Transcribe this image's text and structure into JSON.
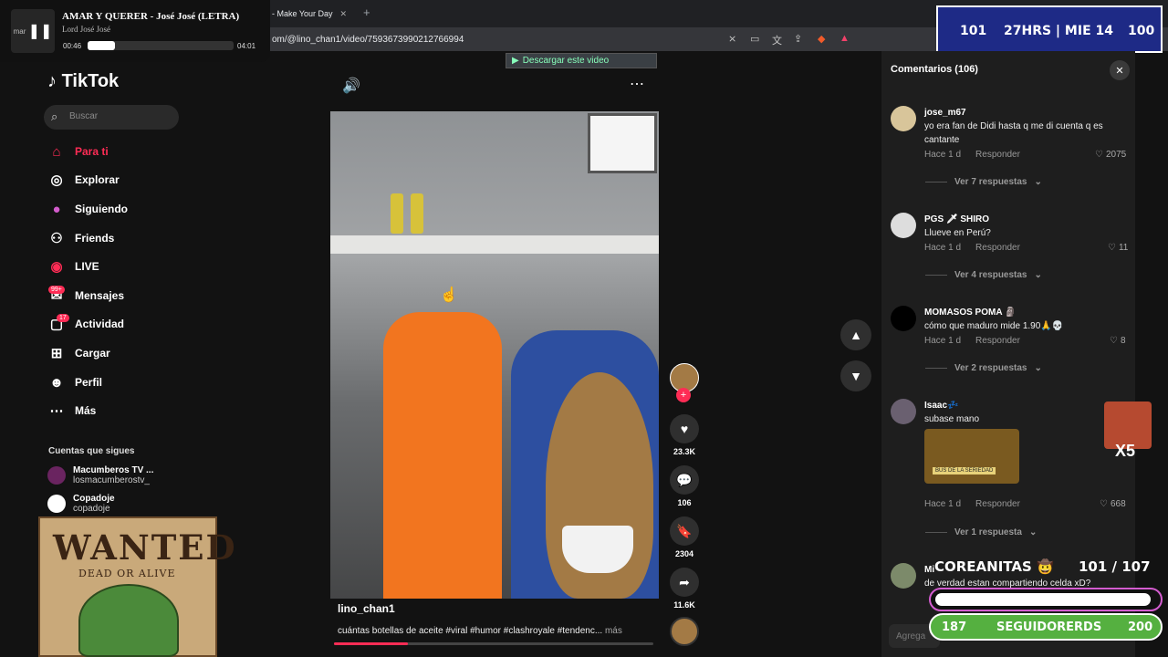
{
  "browser": {
    "tab_title": "- Make Your Day",
    "tab_close": "✕",
    "new_tab": "+",
    "url": "om/@lino_chan1/video/7593673990212766994"
  },
  "music": {
    "art_label": "mar",
    "title": "AMAR Y QUERER - José José (LETRA)",
    "artist": "Lord José José",
    "current": "00:46",
    "duration": "04:01",
    "progress": 0.19
  },
  "stream_top": {
    "left": "101",
    "center": "27HRS | MIE 14",
    "right": "100"
  },
  "download_bar": {
    "label": "Descargar este video"
  },
  "sidebar": {
    "logo": "TikTok",
    "search_placeholder": "Buscar",
    "items": [
      {
        "label": "Para ti",
        "icon": "home-icon"
      },
      {
        "label": "Explorar",
        "icon": "compass-icon"
      },
      {
        "label": "Siguiendo",
        "icon": "following-icon"
      },
      {
        "label": "Friends",
        "icon": "friends-icon"
      },
      {
        "label": "LIVE",
        "icon": "live-icon"
      },
      {
        "label": "Mensajes",
        "icon": "messages-icon",
        "badge": "99+"
      },
      {
        "label": "Actividad",
        "icon": "activity-icon",
        "badge": "17"
      },
      {
        "label": "Cargar",
        "icon": "upload-icon"
      },
      {
        "label": "Perfil",
        "icon": "profile-icon"
      },
      {
        "label": "Más",
        "icon": "more-icon"
      }
    ],
    "following_header": "Cuentas que sigues",
    "accounts": [
      {
        "name": "Macumberos TV ...",
        "handle": "losmacumberostv_"
      },
      {
        "name": "Copadoje",
        "handle": "copadoje"
      }
    ]
  },
  "wanted": {
    "title": "WANTED",
    "subtitle": "DEAD OR ALIVE"
  },
  "video": {
    "author": "lino_chan1",
    "caption": "cuántas botellas de aceite #viral #humor #clashroyale #tendenc...",
    "more": "más",
    "progress": 0.23
  },
  "actions": {
    "likes": "23.3K",
    "comments": "106",
    "saves": "2304",
    "shares": "11.6K"
  },
  "comments": {
    "title": "Comentarios (106)",
    "reply_label": "Responder",
    "items": [
      {
        "user": "jose_m67",
        "text": "yo era fan de Didi hasta q me di cuenta q es cantante",
        "time": "Hace 1 d",
        "likes": "2075",
        "replies": "Ver 7 respuestas"
      },
      {
        "user": "PGS 🗡 SHIRO",
        "text": "Llueve en Perú?",
        "time": "Hace 1 d",
        "likes": "11",
        "replies": "Ver 4 respuestas"
      },
      {
        "user": "MOMASOS POMA 🗿",
        "text": "cómo que maduro mide 1.90🙏💀",
        "time": "Hace 1 d",
        "likes": "8",
        "replies": "Ver 2 respuestas"
      },
      {
        "user": "Isaac💤",
        "text": "subase mano",
        "image_label": "BUS DE LA SERIEDAD",
        "time": "Hace 1 d",
        "likes": "668",
        "replies": "Ver 1 respuesta"
      },
      {
        "user": "Mi",
        "text": "de verdad estan compartiendo celda xD?"
      }
    ],
    "add_placeholder": "Agrega"
  },
  "stream_bottom": {
    "sub_title": "COREANITAS 🤠",
    "sub_count": "101  /  107",
    "follower_left": "187",
    "follower_label": "SEGUIDORERDS",
    "follower_right": "200",
    "emote_mult": "X5"
  },
  "colors": {
    "accent": "#fe2c55",
    "overlay_blue": "#1e2a86",
    "follower_green": "#55b040"
  }
}
